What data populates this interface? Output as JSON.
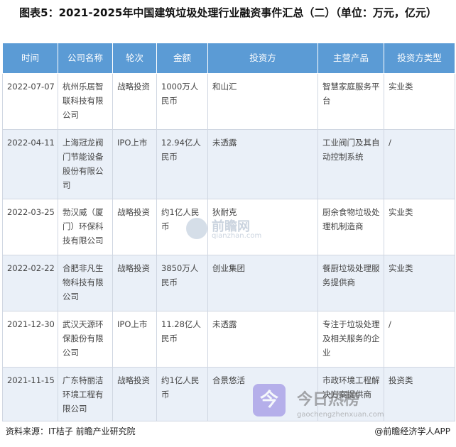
{
  "title": "图表5：2021-2025年中国建筑垃圾处理行业融资事件汇总（二）（单位：万元，亿元）",
  "headers": [
    "时间",
    "公司名称",
    "轮次",
    "金额",
    "投资方",
    "主营产品",
    "投资方类型"
  ],
  "rows": [
    {
      "date": "2022-07-07",
      "company": "杭州乐居智联科技有限公司",
      "round": "战略投资",
      "amount": "1000万人民币",
      "investor": "和山汇",
      "product": "智慧家庭服务平台",
      "investor_type": "实业类"
    },
    {
      "date": "2022-04-11",
      "company": "上海冠龙阀门节能设备股份有限公司",
      "round": "IPO上市",
      "amount": "12.94亿人民币",
      "investor": "未透露",
      "product": "工业阀门及其自动控制系统",
      "investor_type": "/"
    },
    {
      "date": "2022-03-25",
      "company": "勃汉威（厦门）环保科技有限公司",
      "round": "战略投资",
      "amount": "约1亿人民币",
      "investor": "狄耐克",
      "product": "厨余食物垃圾处理机制造商",
      "investor_type": "实业类"
    },
    {
      "date": "2022-02-22",
      "company": "合肥非凡生物科技有限公司",
      "round": "战略投资",
      "amount": "3850万人民币",
      "investor": "创业集团",
      "product": "餐厨垃圾处理服务提供商",
      "investor_type": "实业类"
    },
    {
      "date": "2021-12-30",
      "company": "武汉天源环保股份有限公司",
      "round": "IPO上市",
      "amount": "11.28亿人民币",
      "investor": "未透露",
      "product": "专注于垃圾处理及相关服务的企业",
      "investor_type": "/"
    },
    {
      "date": "2021-11-15",
      "company": "广东特丽洁环境工程有限公司",
      "round": "战略投资",
      "amount": "约1亿人民币",
      "investor": "合景悠活",
      "product": "市政环境工程解决方案提供商",
      "investor_type": "投资类"
    }
  ],
  "footer": {
    "source": "资料来源：IT桔子 前瞻产业研究院",
    "credit": "@前瞻经济学人APP"
  },
  "watermarks": {
    "center_name": "前瞻网",
    "center_url": "qianzhan.com",
    "bottom_badge": "今",
    "bottom_brand": "今日热榜",
    "bottom_site": "gaochengzhenxuan.com"
  },
  "colors": {
    "header_bg": "#5b9bd5",
    "alt_row_bg": "#eaf0f8"
  }
}
